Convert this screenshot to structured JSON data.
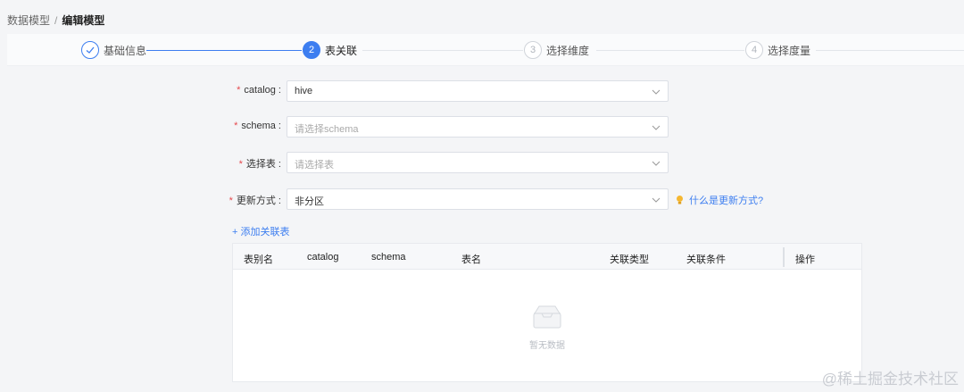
{
  "breadcrumb": {
    "parent": "数据模型",
    "separator": "/",
    "current": "编辑模型"
  },
  "steps": [
    {
      "number": "✓",
      "label": "基础信息",
      "state": "done"
    },
    {
      "number": "2",
      "label": "表关联",
      "state": "active"
    },
    {
      "number": "3",
      "label": "选择维度",
      "state": "pending"
    },
    {
      "number": "4",
      "label": "选择度量",
      "state": "pending"
    }
  ],
  "form": {
    "catalog": {
      "label": "catalog :",
      "value": "hive"
    },
    "schema": {
      "label": "schema :",
      "placeholder": "请选择schema"
    },
    "table": {
      "label": "选择表 :",
      "placeholder": "请选择表"
    },
    "update_mode": {
      "label": "更新方式 :",
      "value": "非分区"
    },
    "required_mark": "*"
  },
  "hint": {
    "text": "什么是更新方式?"
  },
  "add_link": "+ 添加关联表",
  "table": {
    "headers": [
      "表别名",
      "catalog",
      "schema",
      "表名",
      "关联类型",
      "关联条件",
      "操作"
    ],
    "empty_text": "暂无数据"
  },
  "watermark": "@稀土掘金技术社区",
  "colors": {
    "primary": "#3d7ef0",
    "required": "#e5484d"
  }
}
